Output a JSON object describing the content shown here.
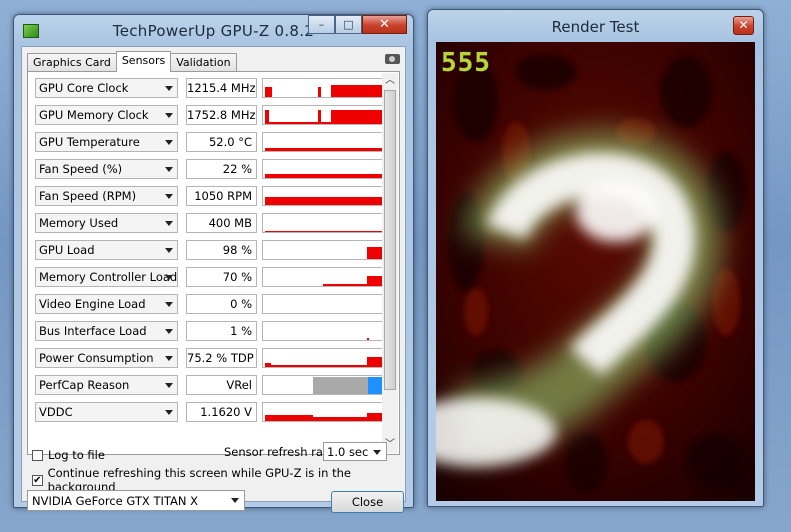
{
  "gpuz": {
    "title": "TechPowerUp GPU-Z 0.8.2",
    "caption_buttons": {
      "minimize": "–",
      "maximize": "□",
      "close": "✕"
    },
    "tabs": [
      {
        "label": "Graphics Card",
        "active": false
      },
      {
        "label": "Sensors",
        "active": true
      },
      {
        "label": "Validation",
        "active": false
      }
    ],
    "sensors": [
      {
        "name": "GPU Core Clock",
        "value": "1215.4 MHz"
      },
      {
        "name": "GPU Memory Clock",
        "value": "1752.8 MHz"
      },
      {
        "name": "GPU Temperature",
        "value": "52.0 °C"
      },
      {
        "name": "Fan Speed (%)",
        "value": "22 %"
      },
      {
        "name": "Fan Speed (RPM)",
        "value": "1050 RPM"
      },
      {
        "name": "Memory Used",
        "value": "400 MB"
      },
      {
        "name": "GPU Load",
        "value": "98 %"
      },
      {
        "name": "Memory Controller Load",
        "value": "70 %"
      },
      {
        "name": "Video Engine Load",
        "value": "0 %"
      },
      {
        "name": "Bus Interface Load",
        "value": "1 %"
      },
      {
        "name": "Power Consumption",
        "value": "75.2 % TDP"
      },
      {
        "name": "PerfCap Reason",
        "value": "VRel"
      },
      {
        "name": "VDDC",
        "value": "1.1620 V"
      }
    ],
    "log_to_file": {
      "label": "Log to file",
      "checked": false
    },
    "continue_refresh": {
      "label": "Continue refreshing this screen while GPU-Z is in the background",
      "checked": true
    },
    "refresh_rate": {
      "label": "Sensor refresh rate:",
      "value": "1.0 sec"
    },
    "gpu_select": "NVIDIA GeForce GTX TITAN X",
    "close_label": "Close",
    "graph_color": "#ee0000",
    "perfcap_colors": {
      "gray": "#a9a9a9",
      "blue": "#1e90ff"
    }
  },
  "render_test": {
    "title": "Render Test",
    "close": "✕",
    "fps": "555",
    "fps_color": "#b6d63a"
  }
}
